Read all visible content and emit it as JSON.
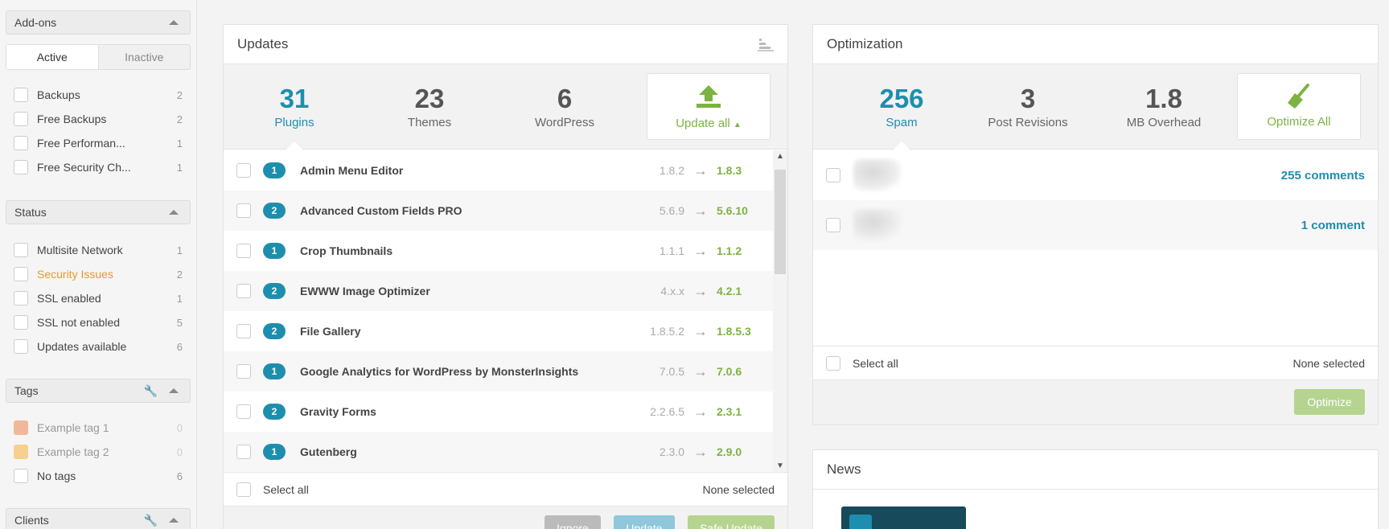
{
  "sidebar": {
    "addons": {
      "title": "Add-ons",
      "tabs": [
        "Active",
        "Inactive"
      ],
      "items": [
        {
          "label": "Backups",
          "count": "2"
        },
        {
          "label": "Free Backups",
          "count": "2"
        },
        {
          "label": "Free Performan...",
          "count": "1"
        },
        {
          "label": "Free Security Ch...",
          "count": "1"
        }
      ]
    },
    "status": {
      "title": "Status",
      "items": [
        {
          "label": "Multisite Network",
          "count": "1"
        },
        {
          "label": "Security Issues",
          "count": "2"
        },
        {
          "label": "SSL enabled",
          "count": "1"
        },
        {
          "label": "SSL not enabled",
          "count": "5"
        },
        {
          "label": "Updates available",
          "count": "6"
        }
      ]
    },
    "tags": {
      "title": "Tags",
      "items": [
        {
          "label": "Example tag 1",
          "count": "0",
          "color": "#f0b89a"
        },
        {
          "label": "Example tag 2",
          "count": "0",
          "color": "#f5d08f"
        },
        {
          "label": "No tags",
          "count": "6"
        }
      ]
    },
    "clients": {
      "title": "Clients"
    }
  },
  "updates": {
    "title": "Updates",
    "stats": [
      {
        "num": "31",
        "label": "Plugins"
      },
      {
        "num": "23",
        "label": "Themes"
      },
      {
        "num": "6",
        "label": "WordPress"
      }
    ],
    "update_all": "Update all",
    "rows": [
      {
        "count": "1",
        "name": "Admin Menu Editor",
        "from": "1.8.2",
        "to": "1.8.3"
      },
      {
        "count": "2",
        "name": "Advanced Custom Fields PRO",
        "from": "5.6.9",
        "to": "5.6.10"
      },
      {
        "count": "1",
        "name": "Crop Thumbnails",
        "from": "1.1.1",
        "to": "1.1.2"
      },
      {
        "count": "2",
        "name": "EWWW Image Optimizer",
        "from": "4.x.x",
        "to": "4.2.1"
      },
      {
        "count": "2",
        "name": "File Gallery",
        "from": "1.8.5.2",
        "to": "1.8.5.3"
      },
      {
        "count": "1",
        "name": "Google Analytics for WordPress by MonsterInsights",
        "from": "7.0.5",
        "to": "7.0.6"
      },
      {
        "count": "2",
        "name": "Gravity Forms",
        "from": "2.2.6.5",
        "to": "2.3.1"
      },
      {
        "count": "1",
        "name": "Gutenberg",
        "from": "2.3.0",
        "to": "2.9.0"
      }
    ],
    "select_all": "Select all",
    "none_selected": "None selected",
    "buttons": {
      "ignore": "Ignore",
      "update": "Update",
      "safe_update": "Safe Update"
    }
  },
  "optimization": {
    "title": "Optimization",
    "stats": [
      {
        "num": "256",
        "label": "Spam"
      },
      {
        "num": "3",
        "label": "Post Revisions"
      },
      {
        "num": "1.8",
        "label": "MB Overhead"
      }
    ],
    "optimize_all": "Optimize All",
    "rows": [
      {
        "link": "255 comments"
      },
      {
        "link": "1 comment"
      }
    ],
    "select_all": "Select all",
    "none_selected": "None selected",
    "optimize_button": "Optimize"
  },
  "news": {
    "title": "News"
  },
  "colors": {
    "accent_blue": "#1d8eae",
    "accent_green": "#7cb342",
    "warning": "#e59a2d"
  }
}
